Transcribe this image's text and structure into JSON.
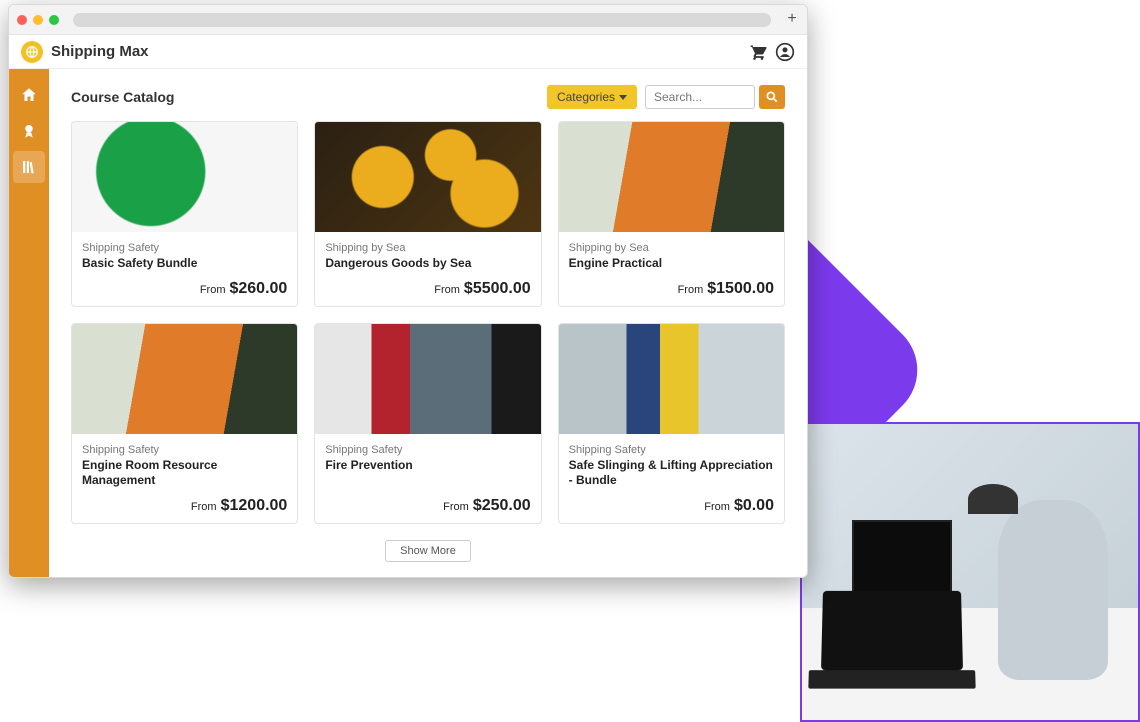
{
  "app": {
    "title": "Shipping Max"
  },
  "page": {
    "title": "Course Catalog",
    "categories_button": "Categories",
    "search_placeholder": "Search...",
    "show_more": "Show More"
  },
  "price_prefix": "From",
  "courses": [
    {
      "category": "Shipping Safety",
      "title": "Basic Safety Bundle",
      "price": "$260.00"
    },
    {
      "category": "Shipping by Sea",
      "title": "Dangerous Goods by Sea",
      "price": "$5500.00"
    },
    {
      "category": "Shipping by Sea",
      "title": "Engine Practical",
      "price": "$1500.00"
    },
    {
      "category": "Shipping Safety",
      "title": "Engine Room Resource Management",
      "price": "$1200.00"
    },
    {
      "category": "Shipping Safety",
      "title": "Fire Prevention",
      "price": "$250.00"
    },
    {
      "category": "Shipping Safety",
      "title": "Safe Slinging & Lifting Appreciation - Bundle",
      "price": "$0.00"
    }
  ]
}
